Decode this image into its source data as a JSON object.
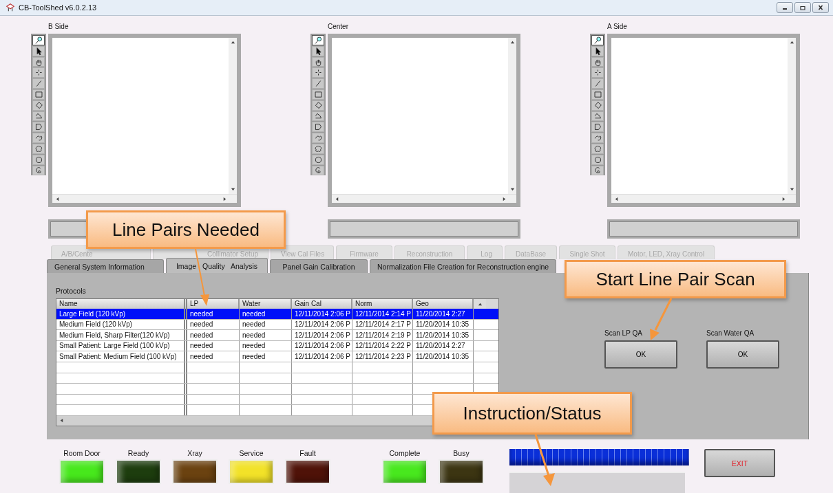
{
  "window": {
    "title": "CB-ToolShed v6.0.2.13"
  },
  "image_panels": [
    {
      "label": "B Side",
      "tools": [
        {
          "kind": "zoom",
          "selected": true
        },
        {
          "kind": "pointer",
          "selected": false
        },
        {
          "kind": "pan",
          "selected": false
        },
        {
          "kind": "point",
          "selected": false
        },
        {
          "kind": "line",
          "selected": false
        },
        {
          "kind": "rectangle",
          "selected": false
        },
        {
          "kind": "rotated-rectangle",
          "selected": false
        },
        {
          "kind": "polyline",
          "selected": false
        },
        {
          "kind": "polygon",
          "selected": false
        },
        {
          "kind": "freehand-line",
          "selected": false
        },
        {
          "kind": "freehand-region",
          "selected": false
        },
        {
          "kind": "oval",
          "selected": false
        },
        {
          "kind": "annulus",
          "selected": false
        }
      ]
    },
    {
      "label": "Center",
      "tools": [
        {
          "kind": "zoom",
          "selected": true
        },
        {
          "kind": "pointer",
          "selected": false
        },
        {
          "kind": "pan",
          "selected": false
        },
        {
          "kind": "point",
          "selected": false
        },
        {
          "kind": "line",
          "selected": false
        },
        {
          "kind": "rectangle",
          "selected": false
        },
        {
          "kind": "rotated-rectangle",
          "selected": false
        },
        {
          "kind": "polyline",
          "selected": false
        },
        {
          "kind": "polygon",
          "selected": false
        },
        {
          "kind": "freehand-line",
          "selected": false
        },
        {
          "kind": "freehand-region",
          "selected": false
        },
        {
          "kind": "oval",
          "selected": false
        },
        {
          "kind": "annulus",
          "selected": false
        }
      ]
    },
    {
      "label": "A Side",
      "tools": [
        {
          "kind": "zoom",
          "selected": true
        },
        {
          "kind": "pointer",
          "selected": false
        },
        {
          "kind": "pan",
          "selected": false
        },
        {
          "kind": "point",
          "selected": false
        },
        {
          "kind": "line",
          "selected": false
        },
        {
          "kind": "rectangle",
          "selected": false
        },
        {
          "kind": "rotated-rectangle",
          "selected": false
        },
        {
          "kind": "polyline",
          "selected": false
        },
        {
          "kind": "polygon",
          "selected": false
        },
        {
          "kind": "freehand-line",
          "selected": false
        },
        {
          "kind": "freehand-region",
          "selected": false
        },
        {
          "kind": "oval",
          "selected": false
        },
        {
          "kind": "annulus",
          "selected": false
        }
      ]
    }
  ],
  "tabs_row_1": [
    {
      "label": "A/B/Cente",
      "selected": false
    },
    {
      "label": "Collimator Setup",
      "selected": false
    },
    {
      "label": "View Cal Files",
      "selected": false
    },
    {
      "label": "Firmware",
      "selected": false
    },
    {
      "label": "Reconstruction",
      "selected": false
    },
    {
      "label": "Log",
      "selected": false
    },
    {
      "label": "DataBase",
      "selected": false
    },
    {
      "label": "Single Shot",
      "selected": false
    },
    {
      "label": "Motor, LED, Xray Control",
      "selected": false
    }
  ],
  "tabs_row_2": [
    {
      "label": "General System Information",
      "selected": false
    },
    {
      "label": "Image Quality Analysis",
      "selected": true
    },
    {
      "label": "Panel Gain Calibration",
      "selected": false
    },
    {
      "label": "Normalization File Creation for Reconstruction engine",
      "selected": false
    }
  ],
  "protocols": {
    "title": "Protocols",
    "columns": [
      "Name",
      "LP",
      "Water",
      "Gain Cal",
      "Norm",
      "Geo"
    ],
    "rows": [
      {
        "selected": true,
        "cells": [
          "Large Field (120 kVp)",
          "needed",
          "needed",
          "12/11/2014 2:06 P",
          "12/11/2014 2:14 P",
          "11/20/2014 2:27"
        ]
      },
      {
        "selected": false,
        "cells": [
          "Medium Field (120 kVp)",
          "needed",
          "needed",
          "12/11/2014 2:06 P",
          "12/11/2014 2:17 P",
          "11/20/2014 10:35"
        ]
      },
      {
        "selected": false,
        "cells": [
          "Medium Field, Sharp Filter(120 kVp)",
          "needed",
          "needed",
          "12/11/2014 2:06 P",
          "12/11/2014 2:19 P",
          "11/20/2014 10:35"
        ]
      },
      {
        "selected": false,
        "cells": [
          "Small Patient: Large Field (100 kVp)",
          "needed",
          "needed",
          "12/11/2014 2:06 P",
          "12/11/2014 2:22 P",
          "11/20/2014 2:27"
        ]
      },
      {
        "selected": false,
        "cells": [
          "Small Patient: Medium Field (100 kVp)",
          "needed",
          "needed",
          "12/11/2014 2:06 P",
          "12/11/2014 2:23 P",
          "11/20/2014 10:35"
        ]
      }
    ]
  },
  "scan_buttons": [
    {
      "label": "Scan LP QA",
      "button": "OK"
    },
    {
      "label": "Scan Water QA",
      "button": "OK"
    }
  ],
  "indicators": [
    {
      "label": "Room Door",
      "color": "#47e81c"
    },
    {
      "label": "Ready",
      "color": "#1d3d0e"
    },
    {
      "label": "Xray",
      "color": "#6b4210"
    },
    {
      "label": "Service",
      "color": "#f2e228"
    },
    {
      "label": "Fault",
      "color": "#4f1208"
    }
  ],
  "process_indicators": [
    {
      "label": "Complete",
      "color": "#48e81e"
    },
    {
      "label": "Busy",
      "color": "#3c3512"
    }
  ],
  "progress": {
    "level": 1
  },
  "exit_button": "EXIT",
  "callouts": [
    {
      "text": "Line Pairs Needed"
    },
    {
      "text": "Start Line Pair Scan"
    },
    {
      "text": "Instruction/Status"
    }
  ]
}
